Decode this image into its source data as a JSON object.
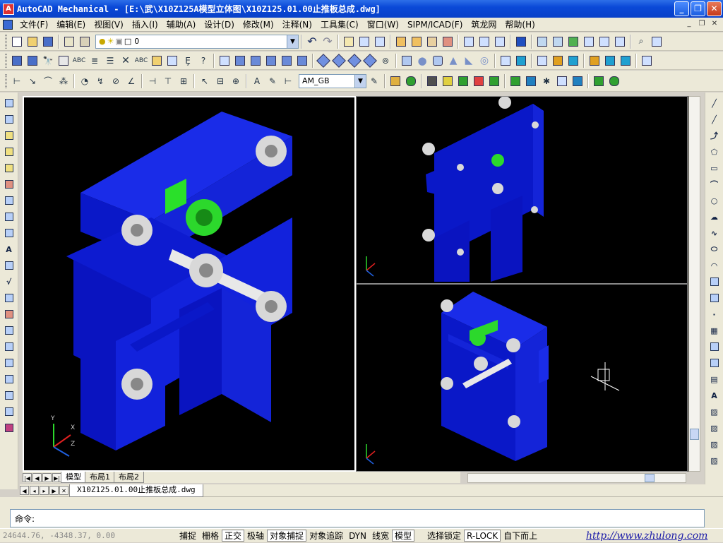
{
  "window": {
    "title": "AutoCAD Mechanical - [E:\\武\\X10Z125A模型立体图\\X10Z125.01.00止推板总成.dwg]",
    "minimize": "_",
    "restore": "❐",
    "close": "✕"
  },
  "menu": {
    "items": [
      "文件(F)",
      "编辑(E)",
      "视图(V)",
      "插入(I)",
      "辅助(A)",
      "设计(D)",
      "修改(M)",
      "注释(N)",
      "工具集(C)",
      "窗口(W)",
      "SIPM/ICAD(F)",
      "筑龙网",
      "帮助(H)"
    ],
    "mdi_min": "_",
    "mdi_restore": "❐",
    "mdi_close": "✕"
  },
  "toolbars": {
    "layer_value": "0",
    "style_value": "AM_GB"
  },
  "layout_tabs": [
    "模型",
    "布局1",
    "布局2"
  ],
  "document_tab": "X10Z125.01.00止推板总成.dwg",
  "command": {
    "prompt": "命令:"
  },
  "status": {
    "coords": "24644.76, -4348.37, 0.00",
    "buttons": [
      {
        "label": "捕捉",
        "on": false
      },
      {
        "label": "栅格",
        "on": false
      },
      {
        "label": "正交",
        "on": true
      },
      {
        "label": "极轴",
        "on": false
      },
      {
        "label": "对象捕捉",
        "on": true
      },
      {
        "label": "对象追踪",
        "on": false
      },
      {
        "label": "DYN",
        "on": false
      },
      {
        "label": "线宽",
        "on": false
      },
      {
        "label": "模型",
        "on": true
      },
      {
        "label": "选择锁定",
        "on": false
      },
      {
        "label": "R-LOCK",
        "on": true
      },
      {
        "label": "自下而上",
        "on": false
      }
    ],
    "url": "http://www.zhulong.com"
  },
  "ucs": {
    "x": "X",
    "y": "Y",
    "z": "Z"
  },
  "colors": {
    "model_blue": "#0a14e6",
    "model_green": "#22d022",
    "model_white": "#e8e8e8",
    "titlebar": "#0a49d8"
  }
}
